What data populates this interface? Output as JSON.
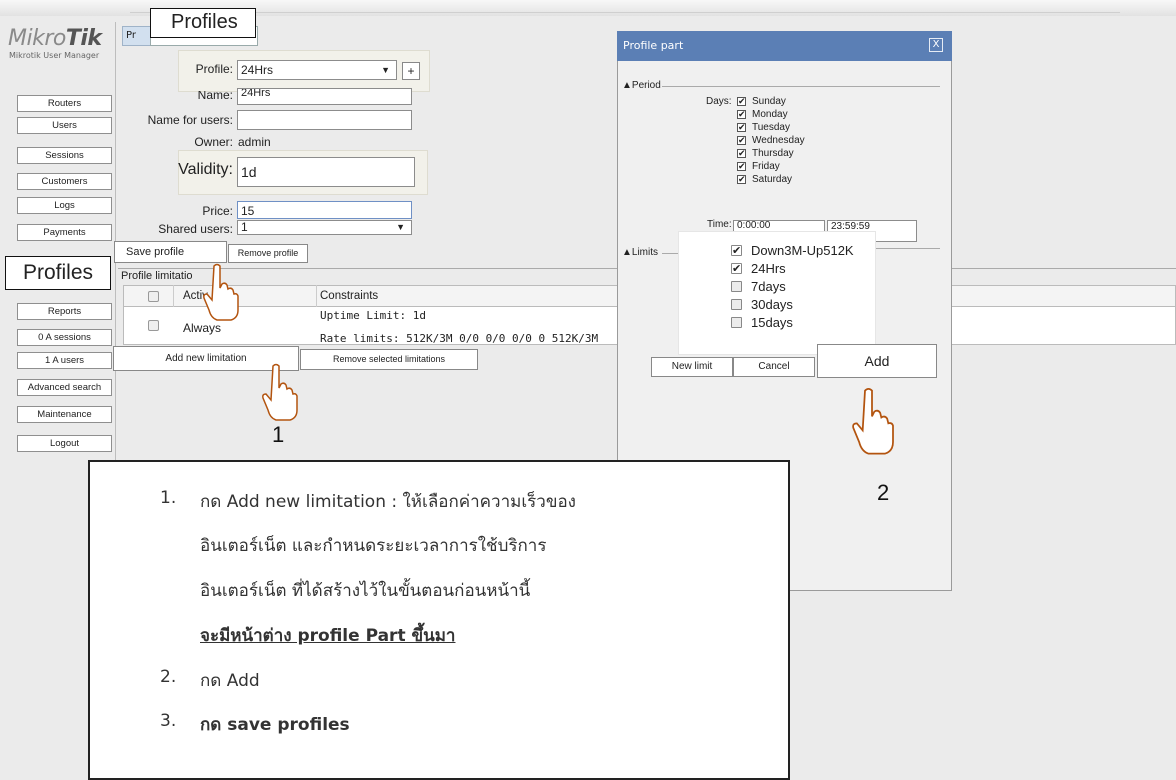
{
  "logo": {
    "brand_light": "Mikro",
    "brand_bold": "Tik",
    "subtitle": "Mikrotik User Manager"
  },
  "nav": [
    "Routers",
    "Users",
    "Sessions",
    "Customers",
    "Logs",
    "Payments",
    "Reports",
    "0 A sessions",
    "1 A users",
    "Advanced search",
    "Maintenance",
    "Logout"
  ],
  "callouts": {
    "profiles_top": "Profiles",
    "profiles_left": "Profiles"
  },
  "tab": {
    "label": "Pr"
  },
  "form": {
    "profile_label": "Profile:",
    "profile_value": "24Hrs",
    "plus_label": "+",
    "name_label": "Name:",
    "name_value": "24Hrs",
    "name_users_label": "Name for users:",
    "name_users_value": "",
    "owner_label": "Owner:",
    "owner_value": "admin",
    "validity_label": "Validity:",
    "validity_value": "1d",
    "price_label": "Price:",
    "price_value": "15",
    "shared_label": "Shared users:",
    "shared_value": "1"
  },
  "buttons": {
    "save_profile": "Save profile",
    "remove_profile": "Remove profile",
    "add_limitation": "Add new limitation",
    "remove_limitations": "Remove selected limitations"
  },
  "limitations": {
    "title": "Profile limitatio",
    "col_active": "Activ",
    "col_constraints": "Constraints",
    "row_active": "Always",
    "row_uptime": "Uptime Limit: 1d",
    "row_rate": "Rate limits: 512K/3M 0/0 0/0 0/0 0 512K/3M"
  },
  "dialog": {
    "title": "Profile part",
    "close": "X",
    "period_label": "▲Period",
    "days_label": "Days:",
    "days": [
      "Sunday",
      "Monday",
      "Tuesday",
      "Wednesday",
      "Thursday",
      "Friday",
      "Saturday"
    ],
    "time_label": "Time:",
    "time_from": "0:00:00",
    "time_to": "23:59:59",
    "limits_label": "▲Limits",
    "limits": [
      {
        "name": "Down3M-Up512K",
        "checked": true
      },
      {
        "name": "24Hrs",
        "checked": true
      },
      {
        "name": "7days",
        "checked": false
      },
      {
        "name": "30days",
        "checked": false
      },
      {
        "name": "15days",
        "checked": false
      }
    ],
    "new_limit": "New limit",
    "cancel": "Cancel",
    "add": "Add"
  },
  "steps_markers": {
    "one": "1",
    "two": "2",
    "three": "3"
  },
  "note": {
    "n1": "1.",
    "line1": "กด Add new limitation : ให้เลือกค่าความเร็วของ",
    "line2": "อินเตอร์เน็ต และกำหนดระยะเวลาการใช้บริการ",
    "line3": "อินเตอร์เน็ต ที่ได้สร้างไว้ในขั้นตอนก่อนหน้านี้",
    "line4": "จะมีหน้าต่าง profile Part ขึ้นมา",
    "n2": "2.",
    "line5": "กด Add",
    "n3": "3.",
    "line6": "กด save profiles"
  }
}
